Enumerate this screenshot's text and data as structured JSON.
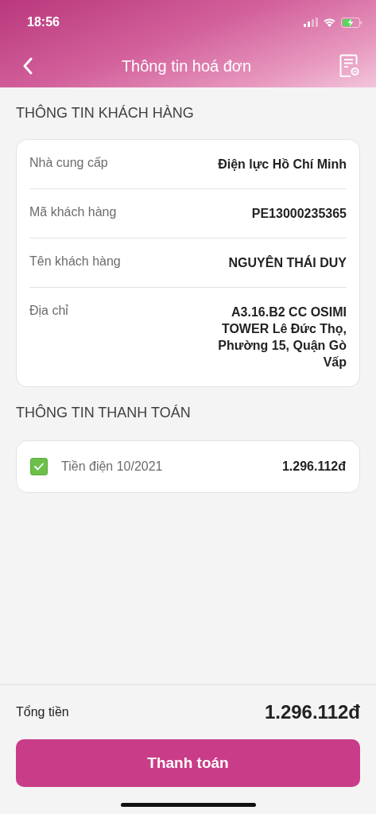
{
  "status_bar": {
    "time": "18:56"
  },
  "nav": {
    "title": "Thông tin hoá đơn"
  },
  "customer_section": {
    "title": "THÔNG TIN KHÁCH HÀNG",
    "rows": [
      {
        "label": "Nhà cung cấp",
        "value": "Điện lực Hồ Chí Minh"
      },
      {
        "label": "Mã khách hàng",
        "value": "PE13000235365"
      },
      {
        "label": "Tên khách hàng",
        "value": "NGUYÊN THÁI DUY"
      },
      {
        "label": "Địa chỉ",
        "value": "A3.16.B2 CC OSIMI TOWER Lê Đức Thọ, Phường 15, Quận Gò Vấp"
      }
    ]
  },
  "payment_section": {
    "title": "THÔNG TIN THANH TOÁN",
    "items": [
      {
        "label": "Tiền điện 10/2021",
        "amount": "1.296.112đ",
        "checked": true
      }
    ]
  },
  "footer": {
    "total_label": "Tổng tiền",
    "total": "1.296.112đ",
    "button": "Thanh toán"
  }
}
